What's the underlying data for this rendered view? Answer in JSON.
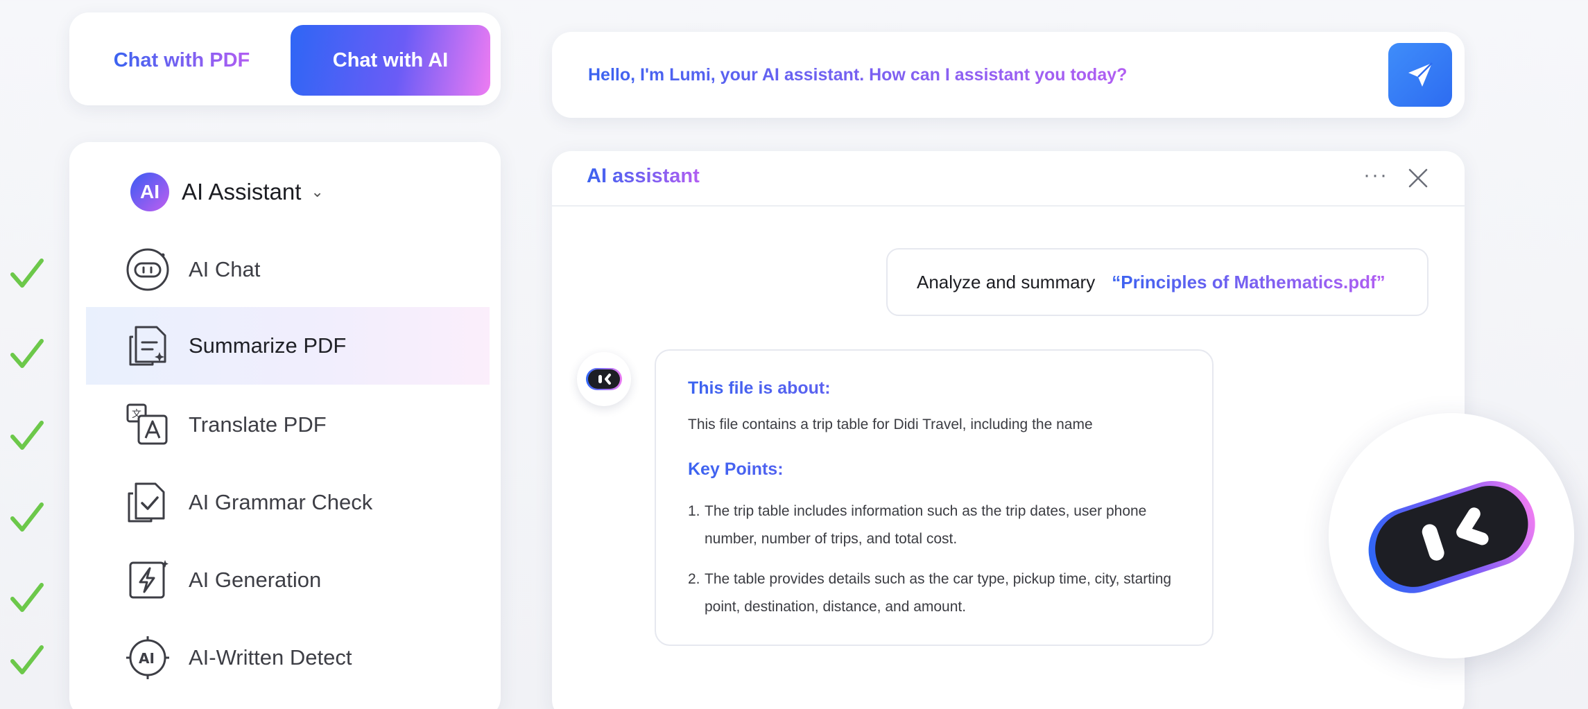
{
  "toggle": {
    "pdf_label": "Chat with PDF",
    "ai_label": "Chat with AI",
    "active": "Chat with AI"
  },
  "sidebar": {
    "header_badge": "AI",
    "header_title": "AI Assistant",
    "header_caret": "⌄",
    "items": [
      {
        "label": "AI Chat",
        "icon": "robot-face-icon",
        "active": false
      },
      {
        "label": "Summarize PDF",
        "icon": "summarize-doc-icon",
        "active": true
      },
      {
        "label": "Translate PDF",
        "icon": "translate-icon",
        "active": false
      },
      {
        "label": "AI Grammar Check",
        "icon": "grammar-check-icon",
        "active": false
      },
      {
        "label": "AI Generation",
        "icon": "lightning-icon",
        "active": false
      },
      {
        "label": "AI-Written Detect",
        "icon": "ai-detect-icon",
        "active": false
      }
    ]
  },
  "prompt": {
    "text": "Hello, I'm Lumi, your AI assistant. How can I assistant you today?",
    "send_icon": "send-icon"
  },
  "panel": {
    "title": "AI assistant",
    "more": "···",
    "user_message": {
      "prefix": "Analyze and summary",
      "file": "“Principles of Mathematics.pdf”"
    },
    "answer": {
      "about_heading": "This file is about:",
      "about_text": "This file contains a trip table for Didi Travel, including the name",
      "key_heading": "Key Points:",
      "points": [
        {
          "num": "1.",
          "text": "The trip table includes information such as the trip dates, user phone number, number of trips, and total cost."
        },
        {
          "num": "2.",
          "text": "The table provides details such as the car type, pickup time, city, starting point, destination, distance, and amount."
        }
      ]
    }
  },
  "colors": {
    "accent_blue": "#2e66f5",
    "accent_purple": "#b25ef2",
    "accent_pink": "#ee7cf2",
    "check_green": "#6cc84a"
  }
}
